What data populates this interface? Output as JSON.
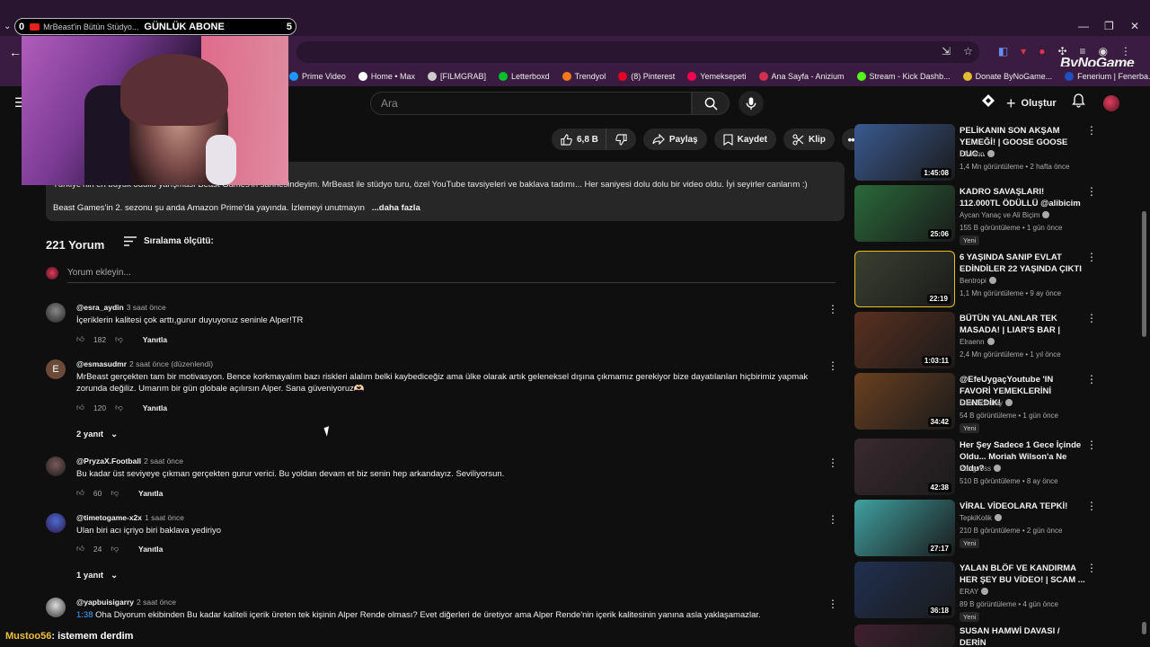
{
  "browser": {
    "tab": {
      "counter_left": "0",
      "title": "MrBeast'in Bütün Stüdyo...",
      "overlay_label": "GÜNLÜK ABONE",
      "counter_right": "5"
    },
    "bookmarks": [
      {
        "label": "Prime Video",
        "color": "#1a98ff"
      },
      {
        "label": "Home • Max",
        "color": "#ffffff"
      },
      {
        "label": "[FILMGRAB]",
        "color": "#cccccc"
      },
      {
        "label": "Letterboxd",
        "color": "#00c030"
      },
      {
        "label": "Trendyol",
        "color": "#f27a1a"
      },
      {
        "label": "(8) Pinterest",
        "color": "#e60023"
      },
      {
        "label": "Yemeksepeti",
        "color": "#fa0050"
      },
      {
        "label": "Ana Sayfa - Anizium",
        "color": "#d03050"
      },
      {
        "label": "Stream - Kick Dashb...",
        "color": "#53fc18"
      },
      {
        "label": "Donate ByNoGame...",
        "color": "#e0c030"
      },
      {
        "label": "Fenerium | Fenerba...",
        "color": "#2050c0"
      }
    ],
    "watermark": "ByNoGame"
  },
  "masthead": {
    "search_placeholder": "Ara",
    "create_label": "Oluştur"
  },
  "actions": {
    "likes": "6,8 B",
    "share": "Paylaş",
    "save": "Kaydet",
    "clip": "Klip"
  },
  "description": {
    "line1": "Türkiye'nin en büyük ödüllü yarışması Beast Games'in sahnesindeyim. MrBeast ile stüdyo turu, özel YouTube tavsiyeleri ve baklava tadımı... Her saniyesi dolu dolu bir video oldu.  İyi seyirler canlarım :)",
    "line2": "Beast Games'in 2. sezonu şu anda Amazon Prime'da yayında. İzlemeyi unutmayın",
    "more": "...daha fazla"
  },
  "comments_header": {
    "count": "221 Yorum",
    "sort": "Sıralama ölçütü:",
    "add_placeholder": "Yorum ekleyin..."
  },
  "comments": [
    {
      "user": "@esra_aydin",
      "time": "3 saat önce",
      "text": "İçeriklerin kalitesi çok arttı,gurur duyuyoruz seninle Alper!TR",
      "likes": "182",
      "reply": "Yanıtla"
    },
    {
      "user": "@esmasudmr",
      "time": "2 saat önce (düzenlendi)",
      "avatar_letter": "E",
      "text": "MrBeast gerçekten tam bir motivasyon. Bence korkmayalım bazı riskleri alalım belki kaybediceğiz ama ülke olarak artık geleneksel dışına çıkmamız gerekiyor bize dayatılanları hiçbirimiz yapmak zorunda değiliz. Umarım bir gün globale açılırsın Alper. Sana güveniyoruz🫶🏻",
      "likes": "120",
      "reply": "Yanıtla",
      "replies": "2 yanıt"
    },
    {
      "user": "@PryzaX.Football",
      "time": "2 saat önce",
      "text": "Bu kadar üst seviyeye çıkman gerçekten gurur verici. Bu yoldan devam et biz senin hep arkandayız. Seviliyorsun.",
      "likes": "60",
      "reply": "Yanıtla"
    },
    {
      "user": "@timetogame-x2x",
      "time": "1 saat önce",
      "text": "Ulan biri acı içriyo biri baklava yediriyo",
      "likes": "24",
      "reply": "Yanıtla",
      "replies": "1 yanıt"
    },
    {
      "user": "@yapbuisigarry",
      "time": "2 saat önce",
      "timestamp": "1:38",
      "text": "Oha Diyorum ekibinden Bu kadar kaliteli içerik üreten tek kişinin Alper Rende olması? Evet diğerleri de üretiyor ama Alper Rende'nin içerik kalitesinin yanına asla yaklaşamazlar."
    }
  ],
  "sidebar": [
    {
      "title": "PELİKANIN SON AKŞAM YEMEĞİ! | GOOSE GOOSE DUC...",
      "channel": "Elraenn",
      "meta": "1,4 Mn görüntüleme • 2 hafta önce",
      "duration": "1:45:08",
      "thumb_color": "#3a5a90"
    },
    {
      "title": "KADRO SAVAŞLARI! 112.000TL ÖDÜLLÜ @alibicim",
      "channel": "Aycan Yanaç ve Ali Biçim",
      "meta": "155 B görüntüleme • 1 gün önce",
      "duration": "25:06",
      "new": "Yeni",
      "thumb_color": "#2a6a3a"
    },
    {
      "title": "6 YAŞINDA SANIP EVLAT EDİNDİLER 22 YAŞINDA ÇIKTI",
      "channel": "Bentropi",
      "meta": "1,1 Mn görüntüleme • 9 ay önce",
      "duration": "22:19",
      "thumb_color": "#3a4030"
    },
    {
      "title": "BÜTÜN YALANLAR TEK MASADA! | LIAR'S BAR |",
      "channel": "Elraenn",
      "meta": "2,4 Mn görüntüleme • 1 yıl önce",
      "duration": "1:03:11",
      "thumb_color": "#5a3020"
    },
    {
      "title": "@EfeUygaçYoutube 'IN FAVORİ YEMEKLERİNİ DENEDİK!",
      "channel": "Fırat Sobutay",
      "meta": "54 B görüntüleme • 1 gün önce",
      "duration": "34:42",
      "new": "Yeni",
      "thumb_color": "#6a4020"
    },
    {
      "title": "Her Şey Sadece 1 Gece İçinde Oldu... Moriah Wilson'a Ne Oldu?",
      "channel": "Pangvoss",
      "meta": "510 B görüntüleme • 8 ay önce",
      "duration": "42:38",
      "thumb_color": "#3a2a30"
    },
    {
      "title": "VİRAL VİDEOLARA TEPKİ!",
      "channel": "TepkiKolik",
      "meta": "210 B görüntüleme • 2 gün önce",
      "duration": "27:17",
      "new": "Yeni",
      "thumb_color": "#40a0a0"
    },
    {
      "title": "YALAN BLÖF VE KANDIRMA HER ŞEY BU VİDEO! | SCAM ...",
      "channel": "ERAY",
      "meta": "89 B görüntüleme • 4 gün önce",
      "duration": "36:18",
      "new": "Yeni",
      "thumb_color": "#203050"
    },
    {
      "title": "SUSAN HAMWİ DAVASI / DERİN",
      "channel": "",
      "meta": "",
      "duration": "",
      "thumb_color": "#402030"
    }
  ],
  "chat": {
    "name": "Mustoo56",
    "message": ": istemem derdim"
  }
}
